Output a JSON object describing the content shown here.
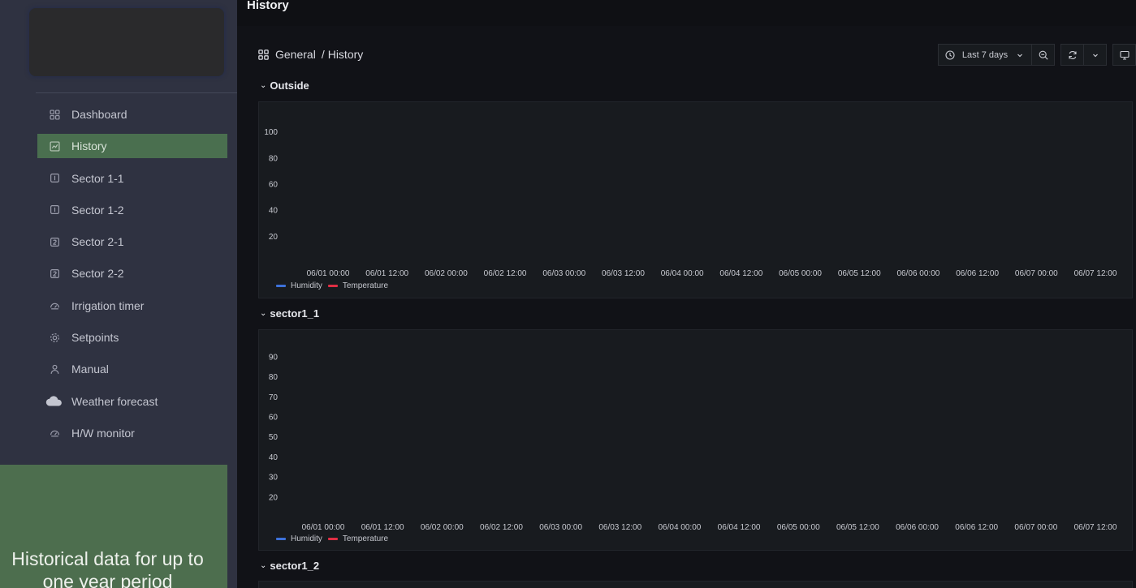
{
  "sidebar": {
    "items": [
      {
        "label": "Dashboard",
        "icon": "grid-icon",
        "active": false
      },
      {
        "label": "History",
        "icon": "chart-icon",
        "active": true
      },
      {
        "label": "Sector 1-1",
        "icon": "sector-1-icon",
        "active": false
      },
      {
        "label": "Sector 1-2",
        "icon": "sector-1-icon",
        "active": false
      },
      {
        "label": "Sector 2-1",
        "icon": "sector-2-icon",
        "active": false
      },
      {
        "label": "Sector 2-2",
        "icon": "sector-2-icon",
        "active": false
      },
      {
        "label": "Irrigation timer",
        "icon": "gauge-icon",
        "active": false
      },
      {
        "label": "Setpoints",
        "icon": "gear-icon",
        "active": false
      },
      {
        "label": "Manual",
        "icon": "user-icon",
        "active": false
      },
      {
        "label": "Weather forecast",
        "icon": "cloud-icon",
        "active": false
      },
      {
        "label": "H/W monitor",
        "icon": "gauge-icon",
        "active": false
      }
    ],
    "promo_line1": "Historical data for up to",
    "promo_line2": "one year period"
  },
  "header": {
    "title": "History",
    "breadcrumb_folder": "General",
    "breadcrumb_sep": "/",
    "breadcrumb_page": "History"
  },
  "toolbar": {
    "time_range": "Last 7 days"
  },
  "colors": {
    "humidity": "#3d71d9",
    "temperature": "#e02f44",
    "active_nav": "#4a6f4f"
  },
  "rows": [
    {
      "title": "Outside"
    },
    {
      "title": "sector1_1"
    },
    {
      "title": "sector1_2"
    }
  ],
  "chart_data": [
    {
      "type": "line",
      "title": "Outside",
      "x_ticks": [
        "06/01 00:00",
        "06/01 12:00",
        "06/02 00:00",
        "06/02 12:00",
        "06/03 00:00",
        "06/03 12:00",
        "06/04 00:00",
        "06/04 12:00",
        "06/05 00:00",
        "06/05 12:00",
        "06/06 00:00",
        "06/06 12:00",
        "06/07 00:00",
        "06/07 12:00"
      ],
      "y_ticks": [
        20,
        40,
        60,
        80,
        100
      ],
      "ylim": [
        0,
        110
      ],
      "series": [
        {
          "name": "Humidity",
          "values": []
        },
        {
          "name": "Temperature",
          "values": []
        }
      ],
      "legend": "bottom-left",
      "grid": false
    },
    {
      "type": "line",
      "title": "sector1_1",
      "x_ticks": [
        "06/01 00:00",
        "06/01 12:00",
        "06/02 00:00",
        "06/02 12:00",
        "06/03 00:00",
        "06/03 12:00",
        "06/04 00:00",
        "06/04 12:00",
        "06/05 00:00",
        "06/05 12:00",
        "06/06 00:00",
        "06/06 12:00",
        "06/07 00:00",
        "06/07 12:00"
      ],
      "y_ticks": [
        20,
        30,
        40,
        50,
        60,
        70,
        80,
        90
      ],
      "ylim": [
        10,
        95
      ],
      "series": [
        {
          "name": "Humidity",
          "values": []
        },
        {
          "name": "Temperature",
          "values": []
        }
      ],
      "legend": "bottom-left",
      "grid": false
    }
  ]
}
